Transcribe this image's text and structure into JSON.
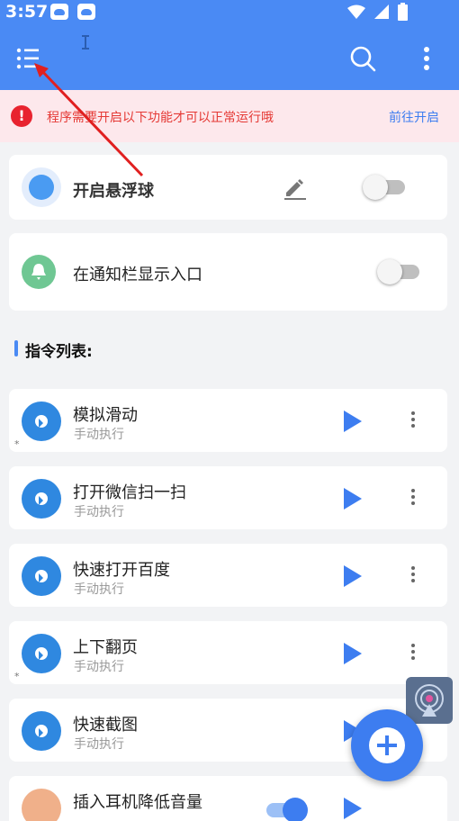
{
  "status_bar": {
    "time": "3:57"
  },
  "banner": {
    "message": "程序需要开启以下功能才可以正常运行哦",
    "action": "前往开启"
  },
  "settings": {
    "floating_ball": {
      "label": "开启悬浮球"
    },
    "notification": {
      "label": "在通知栏显示入口"
    }
  },
  "section": {
    "title": "指令列表:"
  },
  "commands": [
    {
      "name": "模拟滑动",
      "mode": "手动执行"
    },
    {
      "name": "打开微信扫一扫",
      "mode": "手动执行"
    },
    {
      "name": "快速打开百度",
      "mode": "手动执行"
    },
    {
      "name": "上下翻页",
      "mode": "手动执行"
    },
    {
      "name": "快速截图",
      "mode": "手动执行"
    },
    {
      "name": "插入耳机降低音量",
      "mode": ""
    }
  ],
  "colors": {
    "primary": "#4a8af4",
    "danger": "#e8232f",
    "accent": "#3d7df0"
  },
  "icons": [
    "menu-icon",
    "search-icon",
    "more-vert-icon",
    "edit-icon",
    "bell-icon",
    "play-icon",
    "add-icon"
  ]
}
